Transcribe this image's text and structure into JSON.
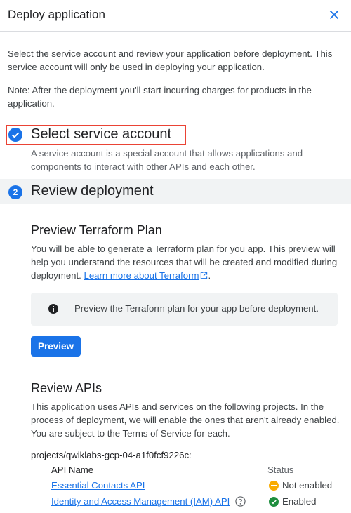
{
  "header": {
    "title": "Deploy application",
    "close_icon": "close-icon"
  },
  "intro": "Select the service account and review your application before deployment. This service account will only be used in deploying your application.",
  "note": "Note: After the deployment you'll start incurring charges for products in the application.",
  "step1": {
    "title": "Select service account",
    "description": "A service account is a special account that allows applications and components to interact with other APIs and each other.",
    "icon": "check-circle-icon",
    "highlight_color": "#ea4335"
  },
  "step2": {
    "number": "2",
    "title": "Review deployment"
  },
  "terraform": {
    "title": "Preview Terraform Plan",
    "description": "You will be able to generate a Terraform plan for you app. This preview will help you understand the resources that will be created and modified during deployment.",
    "link": "Learn more about Terraform",
    "after_link": ".",
    "info": "Preview the Terraform plan for your app before deployment.",
    "button": "Preview"
  },
  "apis": {
    "title": "Review APIs",
    "description": "This application uses APIs and services on the following projects. In the process of deployment, we will enable the ones that aren't already enabled. You are subject to the Terms of Service for each.",
    "project": "projects/qwiklabs-gcp-04-a1f0fcf9226c:",
    "columns": {
      "name": "API Name",
      "status": "Status"
    },
    "rows": [
      {
        "name": "Essential Contacts API",
        "status": "Not enabled",
        "status_color": "#f9ab00"
      },
      {
        "name": "Identity and Access Management (IAM) API",
        "status": "Enabled",
        "status_color": "#1e8e3e"
      }
    ]
  },
  "colors": {
    "accent": "#1a73e8",
    "warning": "#f9ab00",
    "success": "#1e8e3e"
  }
}
